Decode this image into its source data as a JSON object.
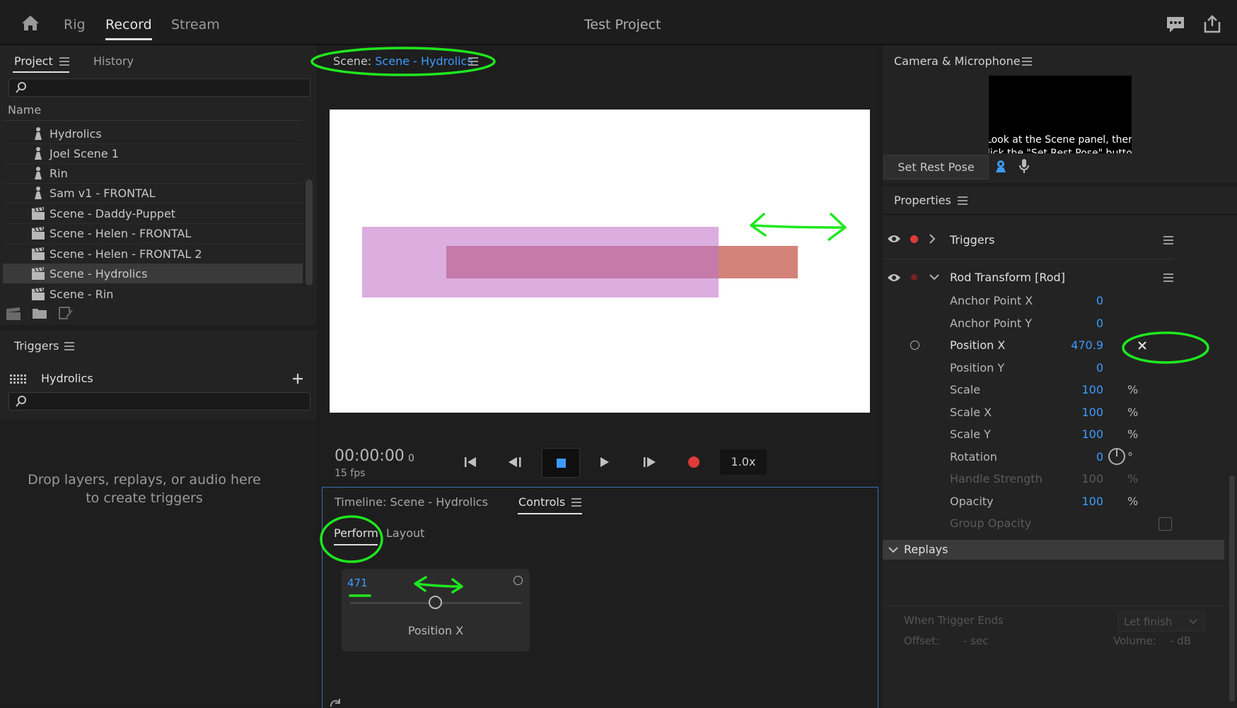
{
  "topbar": {
    "tabs": [
      "Rig",
      "Record",
      "Stream"
    ],
    "active_tab": "Record",
    "title": "Test Project"
  },
  "project_panel": {
    "tabs": [
      "Project",
      "History"
    ],
    "column_header": "Name",
    "items": [
      {
        "label": "Hydrolics",
        "icon": "puppet-icon"
      },
      {
        "label": "Joel Scene 1",
        "icon": "puppet-icon"
      },
      {
        "label": "Rin",
        "icon": "puppet-icon"
      },
      {
        "label": "Sam v1 - FRONTAL",
        "icon": "puppet-icon"
      },
      {
        "label": "Scene - Daddy-Puppet",
        "icon": "clapperboard-icon"
      },
      {
        "label": "Scene - Helen - FRONTAL",
        "icon": "clapperboard-icon"
      },
      {
        "label": "Scene - Helen - FRONTAL 2",
        "icon": "clapperboard-icon"
      },
      {
        "label": "Scene - Hydrolics",
        "icon": "clapperboard-icon",
        "selected": true
      },
      {
        "label": "Scene - Rin",
        "icon": "clapperboard-icon"
      }
    ]
  },
  "triggers_panel": {
    "title": "Triggers",
    "puppet": "Hydrolics",
    "empty_message_line1": "Drop layers, replays, or audio here",
    "empty_message_line2": "to create triggers"
  },
  "scene_panel": {
    "prefix": "Scene:",
    "name": "Scene - Hydrolics",
    "timecode": "00:00:00",
    "frame": "0",
    "fps": "15 fps",
    "speed": "1.0x"
  },
  "timeline_panel": {
    "tabs": [
      "Timeline: Scene - Hydrolics",
      "Controls"
    ],
    "active_tab": "Controls",
    "subtabs": [
      "Perform",
      "Layout"
    ],
    "slider": {
      "value": "471",
      "label": "Position X",
      "fraction": 0.5
    }
  },
  "camera_panel": {
    "title": "Camera & Microphone",
    "hint_line1": "Look at the Scene panel, then",
    "hint_line2": "click the \"Set Rest Pose\" button below",
    "set_rest_pose": "Set Rest Pose"
  },
  "properties_panel": {
    "title": "Properties",
    "triggers_section": "Triggers",
    "transform_section": "Rod Transform [Rod]",
    "rows": [
      {
        "name": "Anchor Point X",
        "value": "0",
        "unit": ""
      },
      {
        "name": "Anchor Point Y",
        "value": "0",
        "unit": ""
      },
      {
        "name": "Position X",
        "value": "470.9",
        "unit": ""
      },
      {
        "name": "Position Y",
        "value": "0",
        "unit": ""
      },
      {
        "name": "Scale",
        "value": "100",
        "unit": "%"
      },
      {
        "name": "Scale X",
        "value": "100",
        "unit": "%"
      },
      {
        "name": "Scale Y",
        "value": "100",
        "unit": "%"
      },
      {
        "name": "Rotation",
        "value": "0",
        "unit": "°"
      },
      {
        "name": "Handle Strength",
        "value": "100",
        "unit": "%"
      },
      {
        "name": "Opacity",
        "value": "100",
        "unit": "%"
      },
      {
        "name": "Group Opacity",
        "value": "",
        "unit": ""
      }
    ],
    "replays_section": "Replays",
    "when_trigger_ends": "When Trigger Ends",
    "let_finish": "Let finish",
    "offset_label": "Offset:",
    "offset_value": "- sec",
    "volume_label": "Volume:",
    "volume_value": "- dB"
  },
  "colors": {
    "accent_blue": "#3d9bff",
    "record_red": "#e03a3a",
    "annotation_green": "#1ee81e",
    "stage_bg": "#ffffff",
    "rect_light": "#dcaee0",
    "rect_dark": "#c57aa9",
    "rect_tip": "#d4837a"
  }
}
